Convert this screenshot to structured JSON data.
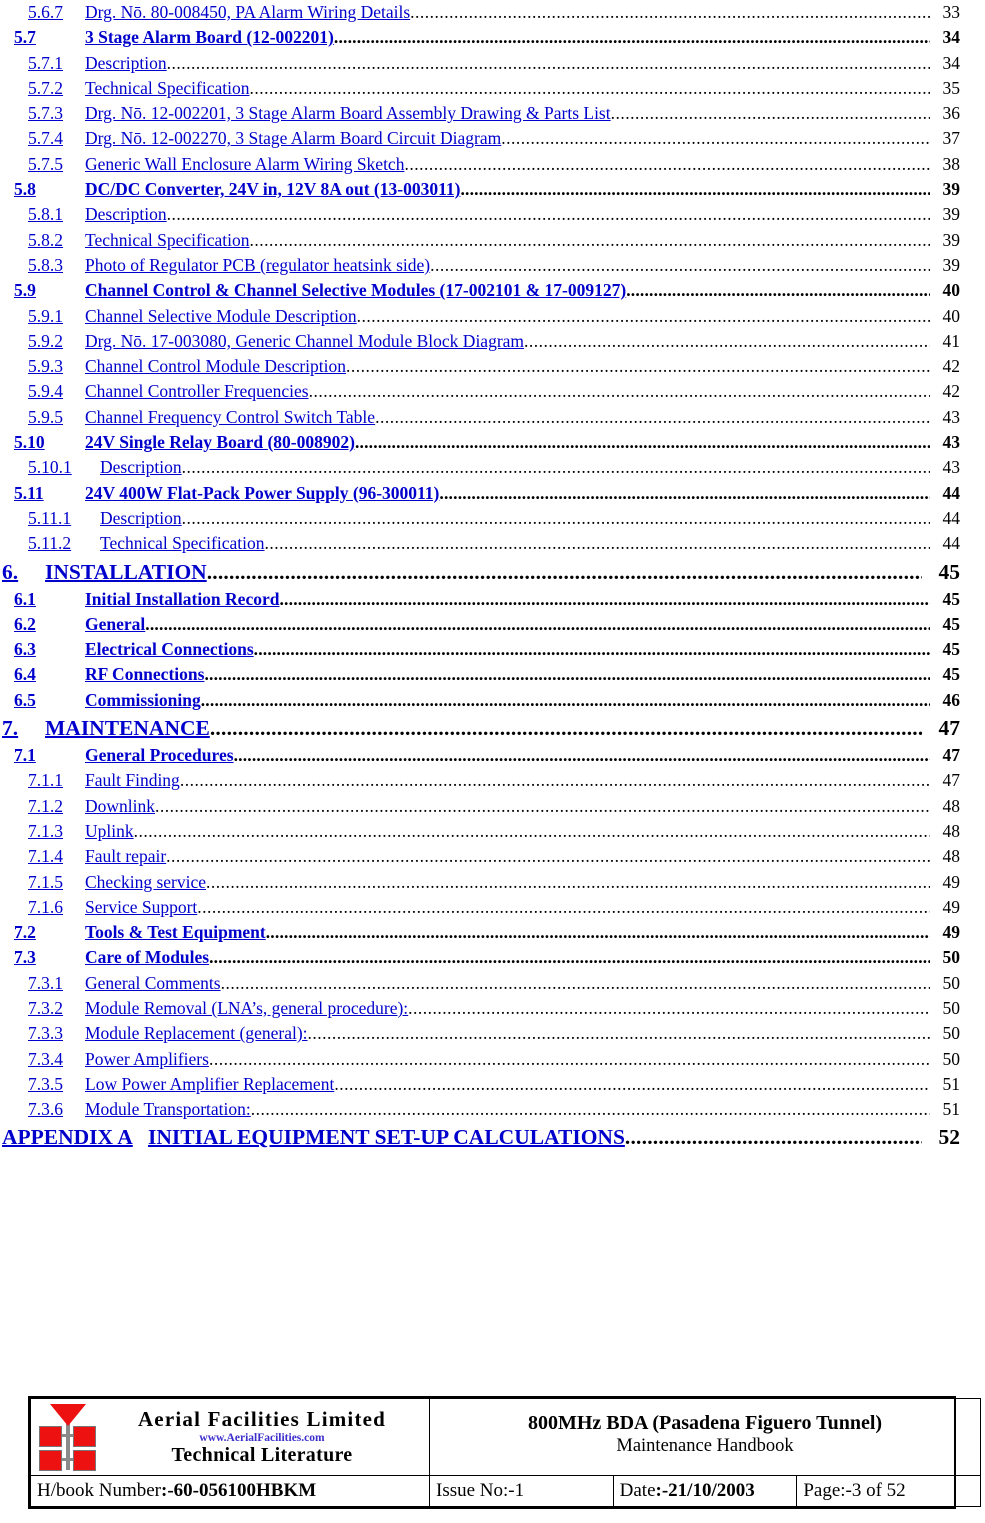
{
  "document": {
    "toc_entries": [
      {
        "level": 3,
        "number": "5.6.7",
        "title": "Drg. Nō. 80-008450, PA Alarm Wiring Details",
        "page": "33"
      },
      {
        "level": 2,
        "number": "5.7",
        "title": "3 Stage Alarm Board (12-002201)",
        "page": "34"
      },
      {
        "level": 3,
        "number": "5.7.1",
        "title": "Description",
        "page": "34"
      },
      {
        "level": 3,
        "number": "5.7.2",
        "title": "Technical Specification",
        "page": "35"
      },
      {
        "level": 3,
        "number": "5.7.3",
        "title": "Drg. Nō. 12-002201, 3 Stage Alarm Board Assembly Drawing & Parts List",
        "page": "36"
      },
      {
        "level": 3,
        "number": "5.7.4",
        "title": "Drg. Nō. 12-002270, 3 Stage Alarm Board Circuit Diagram",
        "page": "37"
      },
      {
        "level": 3,
        "number": "5.7.5",
        "title": "Generic Wall Enclosure Alarm Wiring Sketch",
        "page": "38"
      },
      {
        "level": 2,
        "number": "5.8",
        "title": "DC/DC Converter, 24V in, 12V 8A out (13-003011)",
        "page": "39"
      },
      {
        "level": 3,
        "number": "5.8.1",
        "title": "Description",
        "page": "39"
      },
      {
        "level": 3,
        "number": "5.8.2",
        "title": "Technical Specification",
        "page": "39"
      },
      {
        "level": 3,
        "number": "5.8.3",
        "title": "Photo of Regulator PCB (regulator heatsink side)",
        "page": "39"
      },
      {
        "level": 2,
        "number": "5.9",
        "title": "Channel Control & Channel Selective Modules (17-002101 & 17-009127)",
        "page": "40"
      },
      {
        "level": 3,
        "number": "5.9.1",
        "title": "Channel Selective Module Description",
        "page": "40"
      },
      {
        "level": 3,
        "number": "5.9.2",
        "title": "Drg. Nō. 17-003080, Generic Channel Module Block Diagram",
        "page": "41"
      },
      {
        "level": 3,
        "number": "5.9.3",
        "title": "Channel Control Module Description",
        "page": "42"
      },
      {
        "level": 3,
        "number": "5.9.4",
        "title": "Channel Controller Frequencies",
        "page": "42"
      },
      {
        "level": 3,
        "number": "5.9.5",
        "title": "Channel Frequency Control Switch Table",
        "page": "43"
      },
      {
        "level": 2,
        "number": "5.10",
        "title": "24V Single Relay Board (80-008902)",
        "page": "43"
      },
      {
        "level": 3,
        "number": "5.10.1",
        "title": "Description",
        "page": "43",
        "wide": true
      },
      {
        "level": 2,
        "number": "5.11",
        "title": "24V 400W Flat-Pack Power Supply (96-300011)",
        "page": "44"
      },
      {
        "level": 3,
        "number": "5.11.1",
        "title": "Description",
        "page": "44",
        "wide": true
      },
      {
        "level": 3,
        "number": "5.11.2",
        "title": "Technical Specification",
        "page": "44",
        "wide": true
      },
      {
        "level": 1,
        "number": "6.",
        "title": "INSTALLATION",
        "page": "45"
      },
      {
        "level": 2,
        "number": "6.1",
        "title": "Initial Installation Record",
        "page": "45"
      },
      {
        "level": 2,
        "number": "6.2",
        "title": "General",
        "page": "45"
      },
      {
        "level": 2,
        "number": "6.3",
        "title": "Electrical Connections",
        "page": "45"
      },
      {
        "level": 2,
        "number": "6.4",
        "title": "RF Connections",
        "page": "45"
      },
      {
        "level": 2,
        "number": "6.5",
        "title": "Commissioning",
        "page": "46"
      },
      {
        "level": 1,
        "number": "7.",
        "title": "MAINTENANCE",
        "page": "47"
      },
      {
        "level": 2,
        "number": "7.1",
        "title": "General Procedures",
        "page": "47"
      },
      {
        "level": 3,
        "number": "7.1.1",
        "title": "Fault Finding",
        "page": "47"
      },
      {
        "level": 3,
        "number": "7.1.2",
        "title": "Downlink",
        "page": "48"
      },
      {
        "level": 3,
        "number": "7.1.3",
        "title": "Uplink",
        "page": "48"
      },
      {
        "level": 3,
        "number": "7.1.4",
        "title": "Fault repair",
        "page": "48"
      },
      {
        "level": 3,
        "number": "7.1.5",
        "title": "Checking service",
        "page": "49"
      },
      {
        "level": 3,
        "number": "7.1.6",
        "title": "Service Support",
        "page": "49"
      },
      {
        "level": 2,
        "number": "7.2",
        "title": "Tools & Test Equipment",
        "page": "49"
      },
      {
        "level": 2,
        "number": "7.3",
        "title": "Care of Modules",
        "page": "50"
      },
      {
        "level": 3,
        "number": "7.3.1",
        "title": "General Comments",
        "page": "50"
      },
      {
        "level": 3,
        "number": "7.3.2",
        "title": "Module Removal (LNA’s, general procedure):",
        "page": "50"
      },
      {
        "level": 3,
        "number": "7.3.3",
        "title": "Module Replacement (general):",
        "page": "50"
      },
      {
        "level": 3,
        "number": "7.3.4",
        "title": "Power Amplifiers",
        "page": "50"
      },
      {
        "level": 3,
        "number": "7.3.5",
        "title": "Low Power Amplifier Replacement",
        "page": "51"
      },
      {
        "level": 3,
        "number": "7.3.6",
        "title": "Module Transportation:",
        "page": "51"
      },
      {
        "level": 0,
        "number": "APPENDIX A",
        "title": "INITIAL EQUIPMENT SET-UP CALCULATIONS",
        "page": "52"
      }
    ]
  },
  "footer": {
    "company_name": "Aerial  Facilities  Limited",
    "company_url": "www.AerialFacilities.com",
    "company_tagline": "Technical Literature",
    "doc_title": "800MHz BDA (Pasadena Figuero Tunnel)",
    "doc_subtitle": "Maintenance Handbook",
    "handbook_label": "H/book Number",
    "handbook_value": ":-60-056100HBKM",
    "issue_label": "Issue No",
    "issue_value": ":-1",
    "date_label": "Date",
    "date_value": ":-21/10/2003",
    "page_label": "Page",
    "page_value": ":-3 of 52"
  },
  "colors": {
    "link_blue": "#0000CC",
    "logo_red": "#EE1111",
    "url_purple": "#3B2ECC"
  }
}
